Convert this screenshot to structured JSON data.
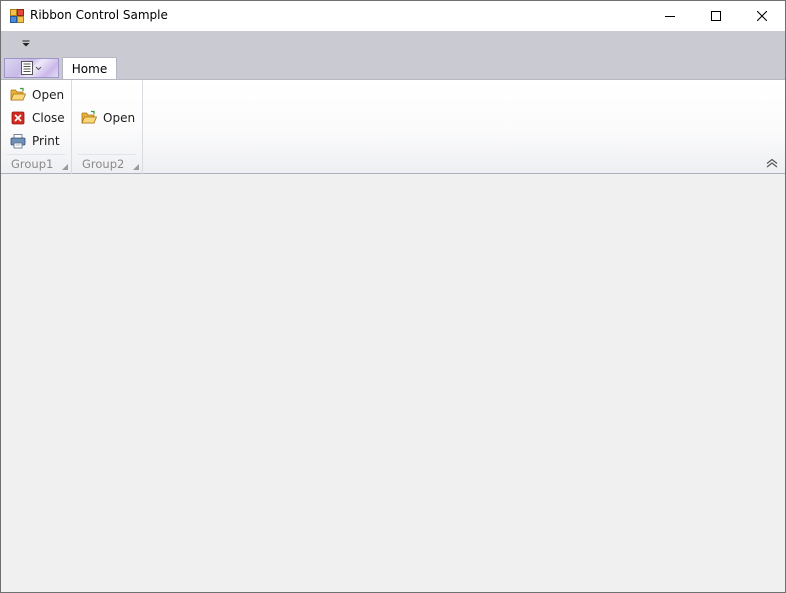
{
  "window": {
    "title": "Ribbon Control Sample"
  },
  "ribbon": {
    "tabs": [
      {
        "label": "Home"
      }
    ],
    "groups": [
      {
        "label": "Group1",
        "items": [
          {
            "label": "Open",
            "icon": "folder-open-icon"
          },
          {
            "label": "Close",
            "icon": "close-red-icon"
          },
          {
            "label": "Print",
            "icon": "printer-icon"
          }
        ]
      },
      {
        "label": "Group2",
        "items": [
          {
            "label": "Open",
            "icon": "folder-open-icon"
          }
        ]
      }
    ]
  },
  "colors": {
    "ribbon_strip": "#c9cad2",
    "client_background": "#f0f0f0",
    "group_label": "#8a8a8a",
    "close_icon_red": "#d42a1f",
    "folder_yellow": "#f2c14e"
  }
}
